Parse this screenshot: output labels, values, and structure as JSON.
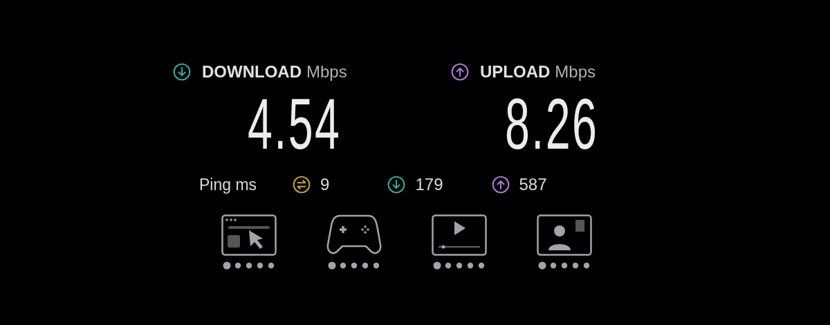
{
  "results": [
    {
      "kind": "download",
      "label": "DOWNLOAD",
      "unit": "Mbps",
      "value": "4.54"
    },
    {
      "kind": "upload",
      "label": "UPLOAD",
      "unit": "Mbps",
      "value": "8.26"
    }
  ],
  "ping": {
    "label": "Ping ms",
    "items": [
      {
        "kind": "idle",
        "value": "9"
      },
      {
        "kind": "download",
        "value": "179"
      },
      {
        "kind": "upload",
        "value": "587"
      }
    ]
  },
  "services": [
    {
      "kind": "browsing"
    },
    {
      "kind": "gaming"
    },
    {
      "kind": "video"
    },
    {
      "kind": "video-call"
    }
  ]
}
